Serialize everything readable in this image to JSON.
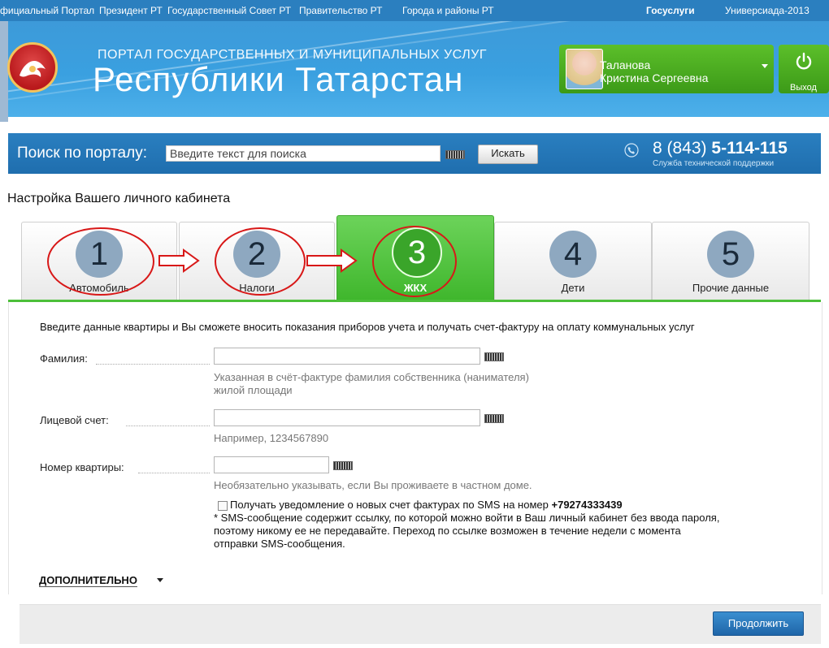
{
  "top_nav": [
    {
      "label": "фициальный Портал",
      "bold": false
    },
    {
      "label": "Президент РТ",
      "bold": false
    },
    {
      "label": "Государственный Совет РТ",
      "bold": false
    },
    {
      "label": "Правительство РТ",
      "bold": false
    },
    {
      "label": "Города и районы РТ",
      "bold": false
    },
    {
      "label": "Госуслуги",
      "bold": true
    },
    {
      "label": "Универсиада-2013",
      "bold": false
    }
  ],
  "header": {
    "subtitle": "ПОРТАЛ ГОСУДАРСТВЕННЫХ И МУНИЦИПАЛЬНЫХ УСЛУГ",
    "title": "Республики Татарстан",
    "user": {
      "last_name": "Таланова",
      "first_names": "Кристина Сергеевна"
    },
    "logout_label": "Выход"
  },
  "search": {
    "label": "Поиск по порталу:",
    "placeholder": "Введите текст для поиска",
    "button_label": "Искать",
    "phone_prefix": "8 (843)",
    "phone_number": "5-114-115",
    "support_label": "Служба технической поддержки"
  },
  "page_title": "Настройка Вашего личного кабинета",
  "tabs": [
    {
      "number": "1",
      "label": "Автомобиль",
      "active": false
    },
    {
      "number": "2",
      "label": "Налоги",
      "active": false
    },
    {
      "number": "3",
      "label": "ЖКХ",
      "active": true
    },
    {
      "number": "4",
      "label": "Дети",
      "active": false
    },
    {
      "number": "5",
      "label": "Прочие данные",
      "active": false
    }
  ],
  "form": {
    "intro": "Введите данные квартиры и Вы сможете вносить показания приборов учета и получать счет-фактуру на оплату коммунальных услуг",
    "surname_label": "Фамилия:",
    "surname_value": "",
    "surname_hint_1": "Указанная в счёт-фактуре фамилия собственника (нанимателя)",
    "surname_hint_2": "жилой площади",
    "account_label": "Лицевой счет:",
    "account_value": "",
    "account_hint": "Например, 1234567890",
    "apartment_label": "Номер квартиры:",
    "apartment_value": "",
    "apartment_hint": "Необязательно указывать, если Вы проживаете в частном доме.",
    "sms_label": "Получать уведомление о новых счет фактурах по SMS на номер",
    "sms_phone": "+79274333439",
    "sms_checked": false,
    "note_1": "* SMS-сообщение содержит ссылку, по которой можно войти в Ваш личный кабинет без ввода пароля,",
    "note_2": "поэтому никому ее не передавайте. Переход по ссылке возможен в течение недели с момента",
    "note_3": "отправки SMS-сообщения.",
    "extra_label": "ДОПОЛНИТЕЛЬНО",
    "continue_label": "Продолжить"
  },
  "colors": {
    "nav_blue": "#2b7fbf",
    "header_blue": "#3aa0e0",
    "accent_green": "#4cbf39",
    "annotation_red": "#d81818",
    "button_blue": "#1f65a8"
  }
}
